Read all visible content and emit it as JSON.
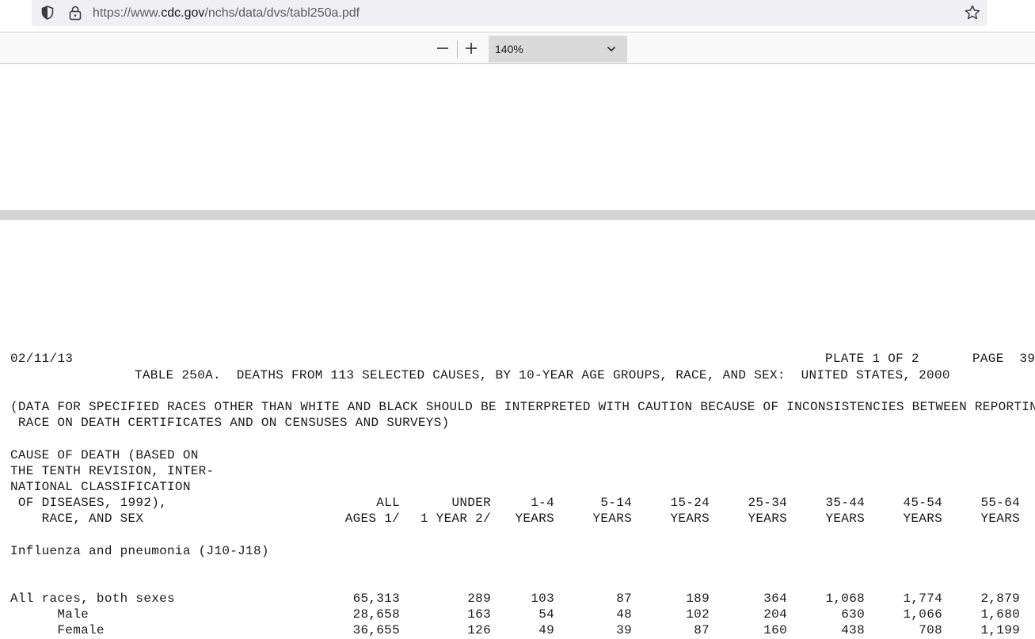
{
  "browser": {
    "url_prefix": "https://www.",
    "url_host": "cdc.gov",
    "url_path": "/nchs/data/dvs/tabl250a.pdf"
  },
  "pdf_toolbar": {
    "zoom_out_label": "—",
    "zoom_in_label": "+",
    "zoom_level": "140%"
  },
  "document": {
    "date": "02/11/13",
    "plate": "PLATE 1 OF 2",
    "page": "PAGE  39",
    "title": "TABLE 250A.  DEATHS FROM 113 SELECTED CAUSES, BY 10-YEAR AGE GROUPS, RACE, AND SEX:  UNITED STATES, 2000",
    "note_line1": "(DATA FOR SPECIFIED RACES OTHER THAN WHITE AND BLACK SHOULD BE INTERPRETED WITH CAUTION BECAUSE OF INCONSISTENCIES BETWEEN REPORTING",
    "note_line2": " RACE ON DEATH CERTIFICATES AND ON CENSUSES AND SURVEYS)",
    "stub_header": [
      "CAUSE OF DEATH (BASED ON",
      "THE TENTH REVISION, INTER-",
      "NATIONAL CLASSIFICATION",
      " OF DISEASES, 1992),",
      "    RACE, AND SEX"
    ],
    "columns": [
      {
        "line1": "ALL",
        "line2": "AGES 1/"
      },
      {
        "line1": "UNDER",
        "line2": "1 YEAR 2/"
      },
      {
        "line1": "1-4",
        "line2": "YEARS"
      },
      {
        "line1": "5-14",
        "line2": "YEARS"
      },
      {
        "line1": "15-24",
        "line2": "YEARS"
      },
      {
        "line1": "25-34",
        "line2": "YEARS"
      },
      {
        "line1": "35-44",
        "line2": "YEARS"
      },
      {
        "line1": "45-54",
        "line2": "YEARS"
      },
      {
        "line1": "55-64",
        "line2": "YEARS"
      }
    ],
    "cause": "Influenza and pneumonia (J10-J18)",
    "rows": [
      {
        "label": "All races, both sexes",
        "values": [
          "65,313",
          "289",
          "103",
          "87",
          "189",
          "364",
          "1,068",
          "1,774",
          "2,879"
        ]
      },
      {
        "label": "      Male",
        "values": [
          "28,658",
          "163",
          "54",
          "48",
          "102",
          "204",
          "630",
          "1,066",
          "1,680"
        ]
      },
      {
        "label": "      Female",
        "values": [
          "36,655",
          "126",
          "49",
          "39",
          "87",
          "160",
          "438",
          "708",
          "1,199"
        ]
      }
    ]
  }
}
